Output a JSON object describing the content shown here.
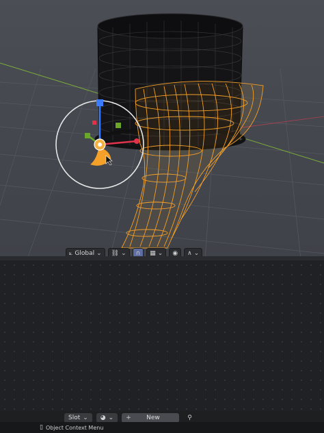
{
  "viewport_header": {
    "orientation_label": "Global",
    "orientation_icon": "transform-orientation-icon",
    "pivot_icon": "link-icon",
    "snap_icon": "magnet-icon",
    "snap_target_icon": "grid-snap-icon",
    "proportional_icon": "proportional-edit-icon",
    "falloff_icon": "falloff-curve-icon"
  },
  "material_bar": {
    "slot_label": "Slot",
    "new_label": "New",
    "add_icon": "plus-icon",
    "browse_icon": "sphere-icon",
    "pin_icon": "pin-icon"
  },
  "status_bar": {
    "mouse_icon": "mouse-icon",
    "text": "Object Context Menu"
  },
  "colors": {
    "selection_orange": "#f5a029",
    "axis_red": "#e0324a",
    "axis_green": "#6aa62a",
    "axis_blue": "#3a7bff",
    "grid_line": "#5a5d63"
  }
}
